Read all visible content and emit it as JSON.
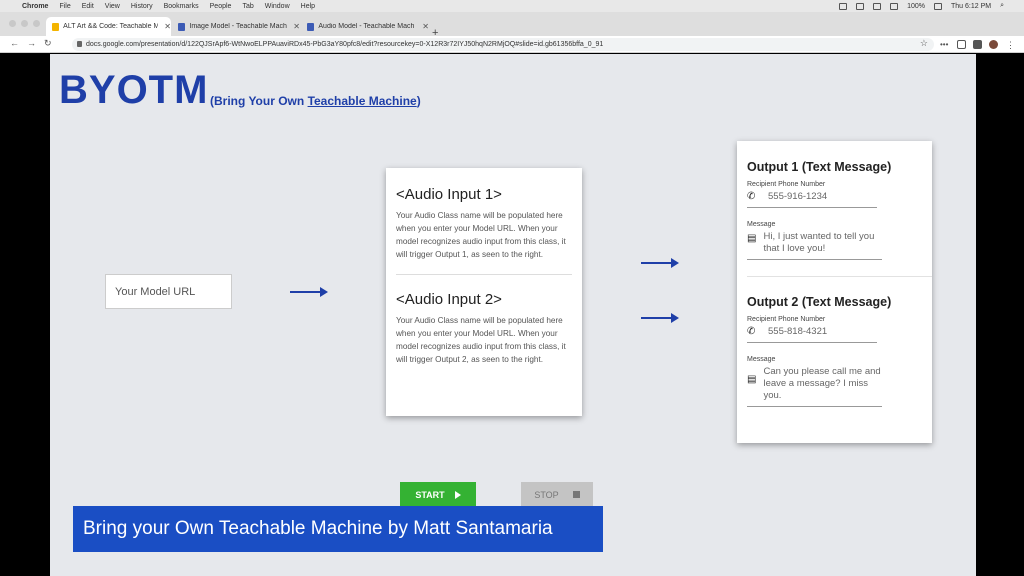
{
  "menubar": {
    "app": "Chrome",
    "items": [
      "File",
      "Edit",
      "View",
      "History",
      "Bookmarks",
      "People",
      "Tab",
      "Window",
      "Help"
    ],
    "battery": "100%",
    "clock": "Thu 6:12 PM"
  },
  "tabs": [
    {
      "title": "ALT Art && Code: Teachable M",
      "icon": "slides-icon",
      "active": true
    },
    {
      "title": "Image Model - Teachable Mach",
      "icon": "tm-icon",
      "active": false
    },
    {
      "title": "Audio Model - Teachable Mach",
      "icon": "tm-icon",
      "active": false
    }
  ],
  "toolbar": {
    "url": "docs.google.com/presentation/d/122QJSrApf6-WtNwoELPPAuaviRDx45-PbG3aY80pfc8/edit?resourcekey=0-X12R3r72IYJ50hqN2RMjOQ#slide=id.gb61356bffa_0_91"
  },
  "slide": {
    "title": "BYOTM",
    "subtitle_prefix": "(Bring Your Own ",
    "subtitle_link": "Teachable Machine",
    "subtitle_suffix": ")",
    "model_url_placeholder": "Your Model URL",
    "audio_inputs": [
      {
        "title": "<Audio Input 1>",
        "desc": "Your Audio Class name will be populated here when you enter your Model URL. When your model recognizes audio input from this class, it will trigger Output 1, as seen to the right."
      },
      {
        "title": "<Audio Input 2>",
        "desc": "Your Audio Class name will be populated here when you enter your Model URL. When your model recognizes audio input from this class, it will trigger Output 2, as seen to the right."
      }
    ],
    "outputs": [
      {
        "title": "Output 1 (Text Message)",
        "phone_label": "Recipient Phone Number",
        "phone": "555-916-1234",
        "message_label": "Message",
        "message": "Hi, I just wanted to tell you that I love you!"
      },
      {
        "title": "Output 2 (Text Message)",
        "phone_label": "Recipient Phone Number",
        "phone": "555-818-4321",
        "message_label": "Message",
        "message": "Can you please call me and leave a message? I miss you."
      }
    ],
    "start_label": "START",
    "stop_label": "STOP",
    "caption": "Bring your Own Teachable Machine by Matt Santamaria"
  }
}
